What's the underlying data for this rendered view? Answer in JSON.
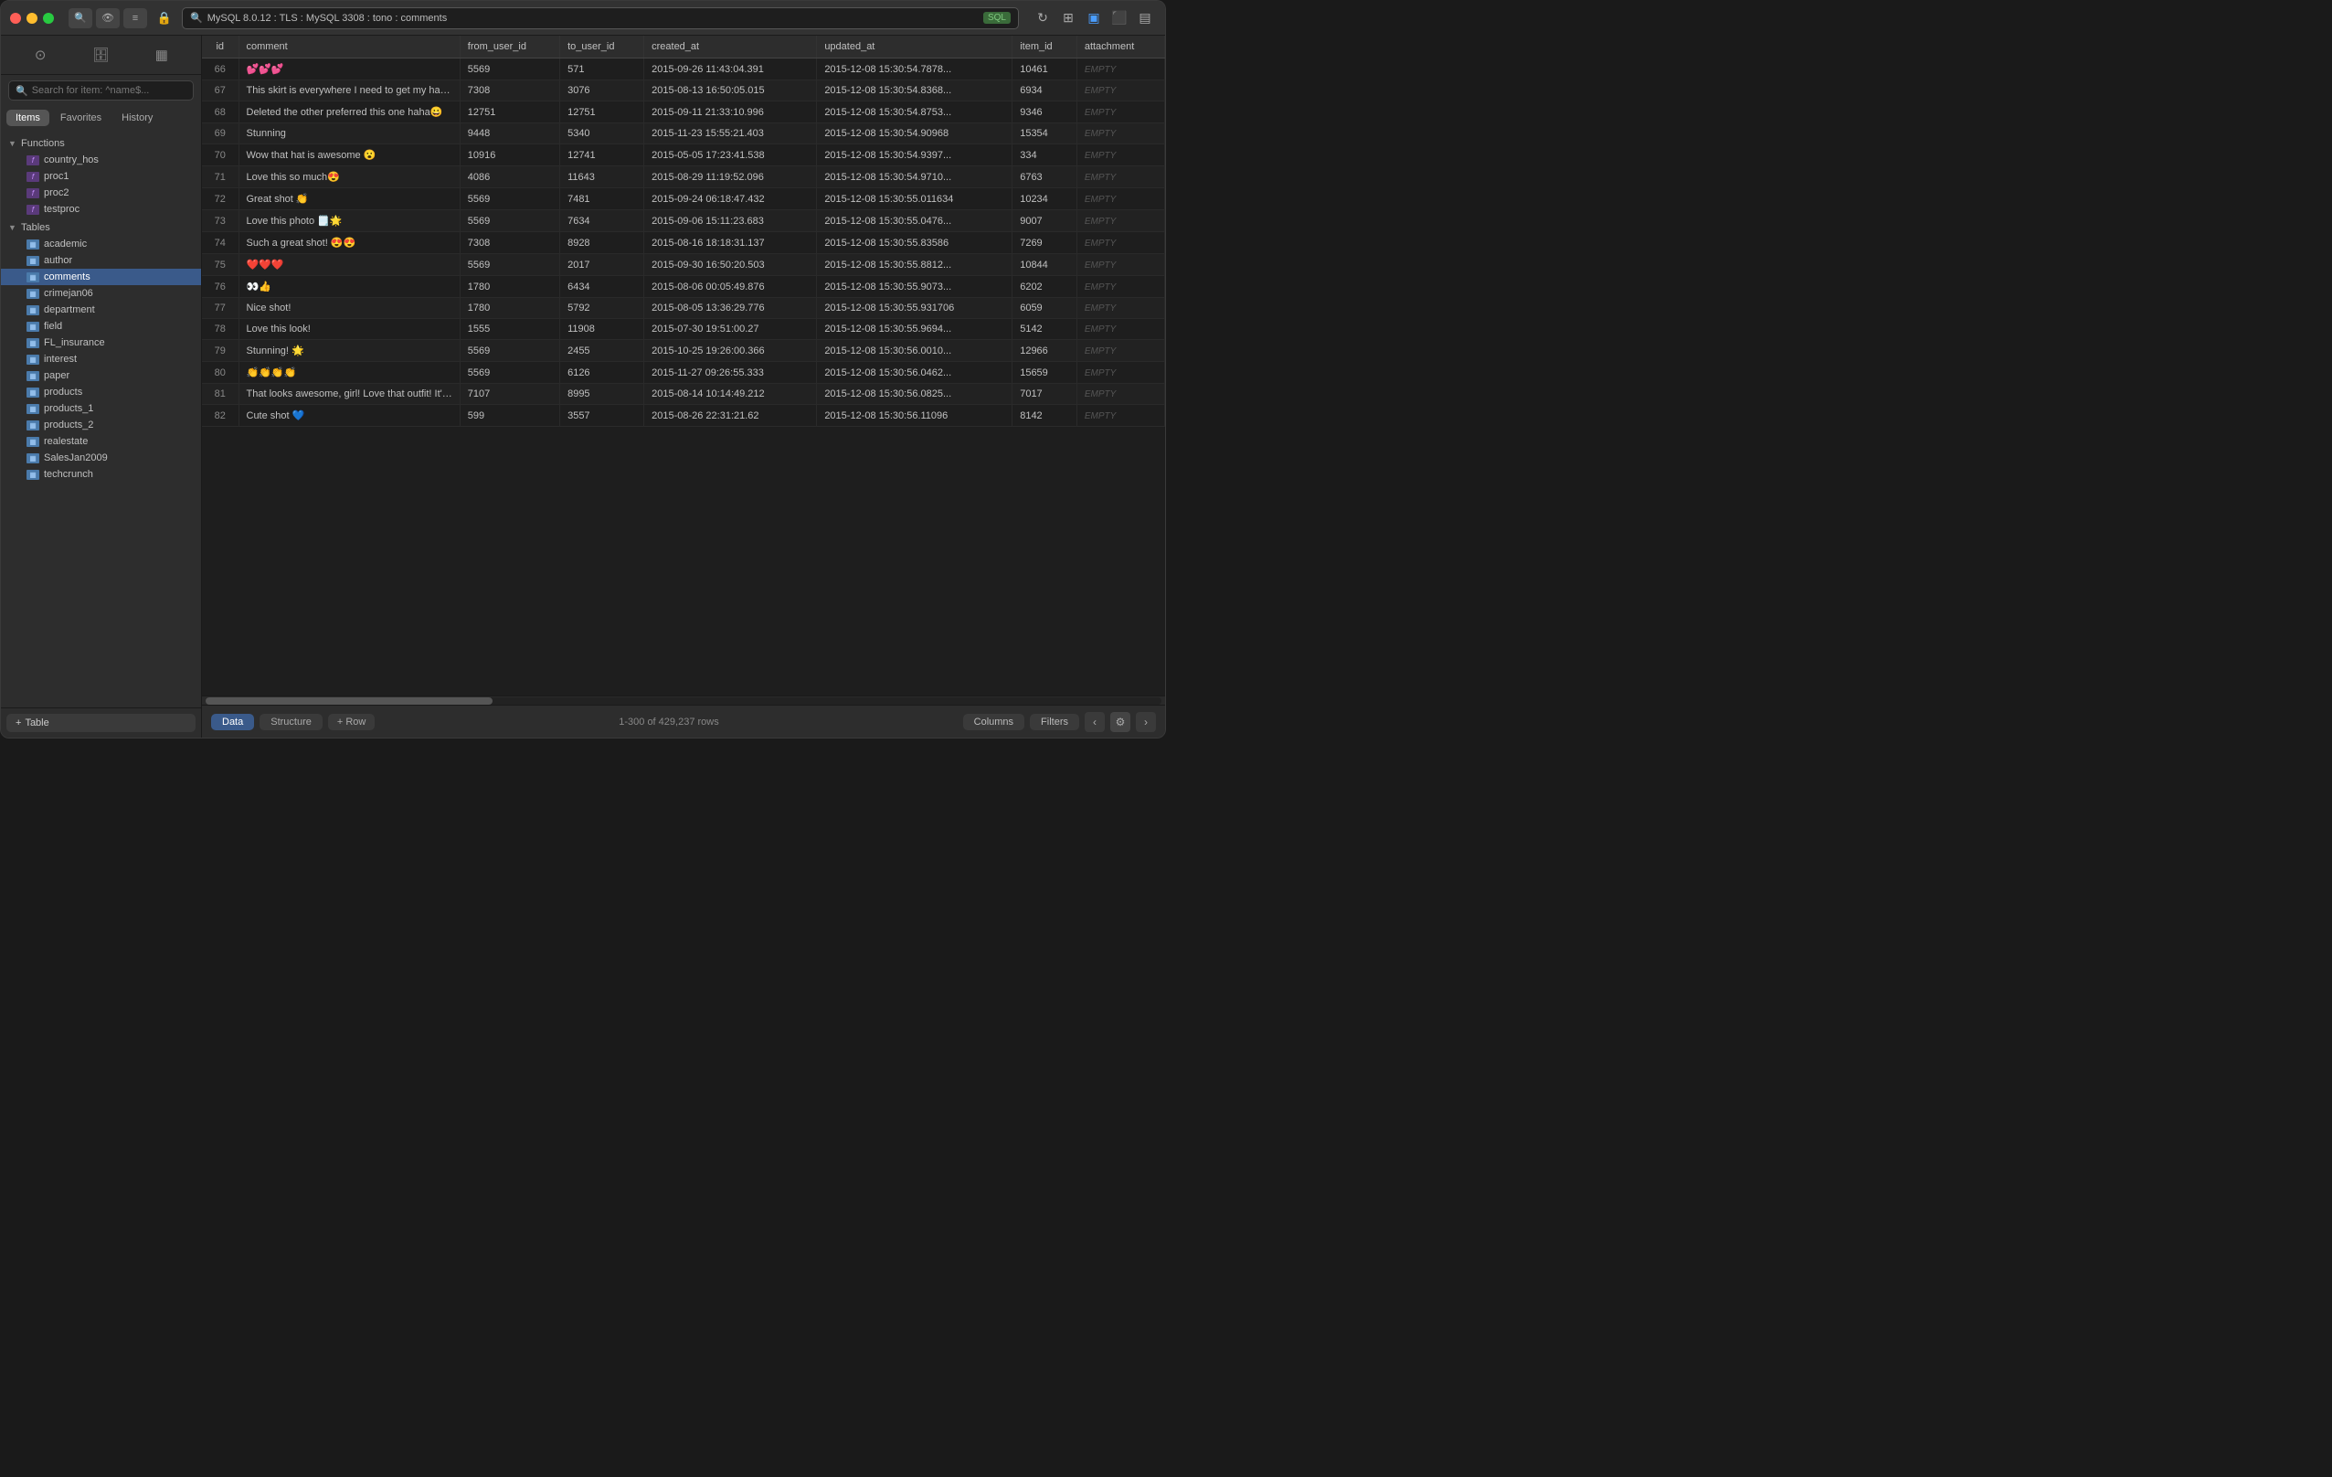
{
  "window": {
    "title": "MySQL 8.0.12 : TLS : MySQL 3308 : tono : comments"
  },
  "titlebar": {
    "search_placeholder": "MySQL 8.0.12 : TLS : MySQL 3308 : tono : comments",
    "sql_badge": "SQL",
    "icons": {
      "eye": "👁",
      "list": "≡",
      "lock": "🔒",
      "search": "🔍",
      "refresh": "↻",
      "grid": "⊞",
      "split_h": "⬜",
      "split_v": "⬛",
      "panel": "▣"
    }
  },
  "sidebar": {
    "search_placeholder": "Search for item: ^name$...",
    "tabs": [
      "Items",
      "Favorites",
      "History"
    ],
    "active_tab": "Items",
    "sections": {
      "functions": {
        "label": "Functions",
        "items": [
          "country_hos",
          "proc1",
          "proc2",
          "testproc"
        ]
      },
      "tables": {
        "label": "Tables",
        "items": [
          "academic",
          "author",
          "comments",
          "crimejan06",
          "department",
          "field",
          "FL_insurance",
          "interest",
          "paper",
          "products",
          "products_1",
          "products_2",
          "realestate",
          "SalesJan2009",
          "techcrunch"
        ]
      }
    },
    "active_table": "comments",
    "add_table_label": "+ Table"
  },
  "table": {
    "columns": [
      "id",
      "comment",
      "from_user_id",
      "to_user_id",
      "created_at",
      "updated_at",
      "item_id",
      "attachment"
    ],
    "rows": [
      {
        "id": 66,
        "comment": "💕💕💕",
        "from_user_id": 5569,
        "to_user_id": 571,
        "created_at": "2015-09-26 11:43:04.391",
        "updated_at": "2015-12-08 15:30:54.7878...",
        "item_id": 10461,
        "attachment": "EMPTY"
      },
      {
        "id": 67,
        "comment": "This skirt is everywhere I need to get my hands on it!...",
        "from_user_id": 7308,
        "to_user_id": 3076,
        "created_at": "2015-08-13 16:50:05.015",
        "updated_at": "2015-12-08 15:30:54.8368...",
        "item_id": 6934,
        "attachment": "EMPTY"
      },
      {
        "id": 68,
        "comment": "Deleted the other preferred this one haha😀",
        "from_user_id": 12751,
        "to_user_id": 12751,
        "created_at": "2015-09-11 21:33:10.996",
        "updated_at": "2015-12-08 15:30:54.8753...",
        "item_id": 9346,
        "attachment": "EMPTY"
      },
      {
        "id": 69,
        "comment": "Stunning",
        "from_user_id": 9448,
        "to_user_id": 5340,
        "created_at": "2015-11-23 15:55:21.403",
        "updated_at": "2015-12-08 15:30:54.90968",
        "item_id": 15354,
        "attachment": "EMPTY"
      },
      {
        "id": 70,
        "comment": "Wow that hat is awesome 😮",
        "from_user_id": 10916,
        "to_user_id": 12741,
        "created_at": "2015-05-05 17:23:41.538",
        "updated_at": "2015-12-08 15:30:54.9397...",
        "item_id": 334,
        "attachment": "EMPTY"
      },
      {
        "id": 71,
        "comment": "Love this so much😍",
        "from_user_id": 4086,
        "to_user_id": 11643,
        "created_at": "2015-08-29 11:19:52.096",
        "updated_at": "2015-12-08 15:30:54.9710...",
        "item_id": 6763,
        "attachment": "EMPTY"
      },
      {
        "id": 72,
        "comment": "Great shot 👏",
        "from_user_id": 5569,
        "to_user_id": 7481,
        "created_at": "2015-09-24 06:18:47.432",
        "updated_at": "2015-12-08 15:30:55.011634",
        "item_id": 10234,
        "attachment": "EMPTY"
      },
      {
        "id": 73,
        "comment": "Love this photo 🗒️🌟",
        "from_user_id": 5569,
        "to_user_id": 7634,
        "created_at": "2015-09-06 15:11:23.683",
        "updated_at": "2015-12-08 15:30:55.0476...",
        "item_id": 9007,
        "attachment": "EMPTY"
      },
      {
        "id": 74,
        "comment": "Such a great shot! 😍😍",
        "from_user_id": 7308,
        "to_user_id": 8928,
        "created_at": "2015-08-16 18:18:31.137",
        "updated_at": "2015-12-08 15:30:55.83586",
        "item_id": 7269,
        "attachment": "EMPTY"
      },
      {
        "id": 75,
        "comment": "❤️❤️❤️",
        "from_user_id": 5569,
        "to_user_id": 2017,
        "created_at": "2015-09-30 16:50:20.503",
        "updated_at": "2015-12-08 15:30:55.8812...",
        "item_id": 10844,
        "attachment": "EMPTY"
      },
      {
        "id": 76,
        "comment": "👀👍",
        "from_user_id": 1780,
        "to_user_id": 6434,
        "created_at": "2015-08-06 00:05:49.876",
        "updated_at": "2015-12-08 15:30:55.9073...",
        "item_id": 6202,
        "attachment": "EMPTY"
      },
      {
        "id": 77,
        "comment": "Nice shot!",
        "from_user_id": 1780,
        "to_user_id": 5792,
        "created_at": "2015-08-05 13:36:29.776",
        "updated_at": "2015-12-08 15:30:55.931706",
        "item_id": 6059,
        "attachment": "EMPTY"
      },
      {
        "id": 78,
        "comment": "Love this look!",
        "from_user_id": 1555,
        "to_user_id": 11908,
        "created_at": "2015-07-30 19:51:00.27",
        "updated_at": "2015-12-08 15:30:55.9694...",
        "item_id": 5142,
        "attachment": "EMPTY"
      },
      {
        "id": 79,
        "comment": "Stunning! 🌟",
        "from_user_id": 5569,
        "to_user_id": 2455,
        "created_at": "2015-10-25 19:26:00.366",
        "updated_at": "2015-12-08 15:30:56.0010...",
        "item_id": 12966,
        "attachment": "EMPTY"
      },
      {
        "id": 80,
        "comment": "👏👏👏👏",
        "from_user_id": 5569,
        "to_user_id": 6126,
        "created_at": "2015-11-27 09:26:55.333",
        "updated_at": "2015-12-08 15:30:56.0462...",
        "item_id": 15659,
        "attachment": "EMPTY"
      },
      {
        "id": 81,
        "comment": "That looks awesome, girl! Love that outfit! It's your o...",
        "from_user_id": 7107,
        "to_user_id": 8995,
        "created_at": "2015-08-14 10:14:49.212",
        "updated_at": "2015-12-08 15:30:56.0825...",
        "item_id": 7017,
        "attachment": "EMPTY"
      },
      {
        "id": 82,
        "comment": "Cute shot 💙",
        "from_user_id": 599,
        "to_user_id": 3557,
        "created_at": "2015-08-26 22:31:21.62",
        "updated_at": "2015-12-08 15:30:56.11096",
        "item_id": 8142,
        "attachment": "EMPTY"
      }
    ]
  },
  "bottom_bar": {
    "data_tab": "Data",
    "structure_tab": "Structure",
    "add_row": "+ Row",
    "row_count": "1-300 of 429,237 rows",
    "columns_btn": "Columns",
    "filters_btn": "Filters"
  }
}
